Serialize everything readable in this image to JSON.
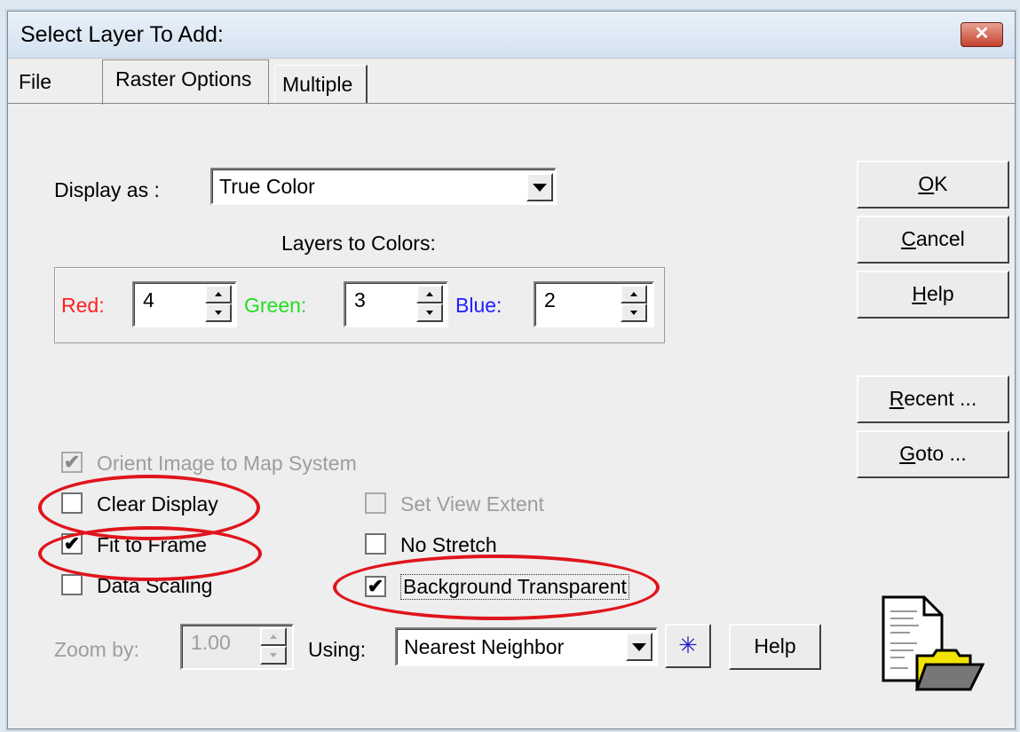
{
  "window": {
    "title": "Select Layer To Add:",
    "close_glyph": "✕"
  },
  "tabs": [
    "File",
    "Raster Options",
    "Multiple"
  ],
  "display_as": {
    "label": "Display as :",
    "value": "True Color"
  },
  "layers_to_colors": {
    "heading": "Layers to Colors:",
    "red": {
      "label": "Red:",
      "value": "4",
      "color": "#ff2020"
    },
    "green": {
      "label": "Green:",
      "value": "3",
      "color": "#22dd22"
    },
    "blue": {
      "label": "Blue:",
      "value": "2",
      "color": "#2020ff"
    }
  },
  "buttons": {
    "ok": {
      "key": "O",
      "rest": "K"
    },
    "cancel": {
      "key": "C",
      "rest": "ancel"
    },
    "help_top": {
      "key": "H",
      "rest": "elp"
    },
    "recent": {
      "key": "R",
      "rest": "ecent ..."
    },
    "goto": {
      "key": "G",
      "rest": "oto ..."
    },
    "help_bottom": "Help",
    "asterisk_glyph": "✳"
  },
  "checkboxes": {
    "orient_image": {
      "label": "Orient Image to Map System",
      "checked": true,
      "enabled": false
    },
    "clear_display": {
      "label": "Clear Display",
      "checked": false
    },
    "set_view_extent": {
      "label": "Set View Extent",
      "checked": false,
      "enabled": false
    },
    "fit_to_frame": {
      "label": "Fit to Frame",
      "checked": true
    },
    "no_stretch": {
      "label": "No Stretch",
      "checked": false
    },
    "data_scaling": {
      "label": "Data Scaling",
      "checked": false
    },
    "background_transparent": {
      "label": "Background Transparent",
      "checked": true
    },
    "check_glyph": "✔"
  },
  "zoom": {
    "label": "Zoom by:",
    "value": "1.00"
  },
  "using": {
    "label": "Using:",
    "value": "Nearest Neighbor"
  },
  "annotation_color": "#e0141c"
}
